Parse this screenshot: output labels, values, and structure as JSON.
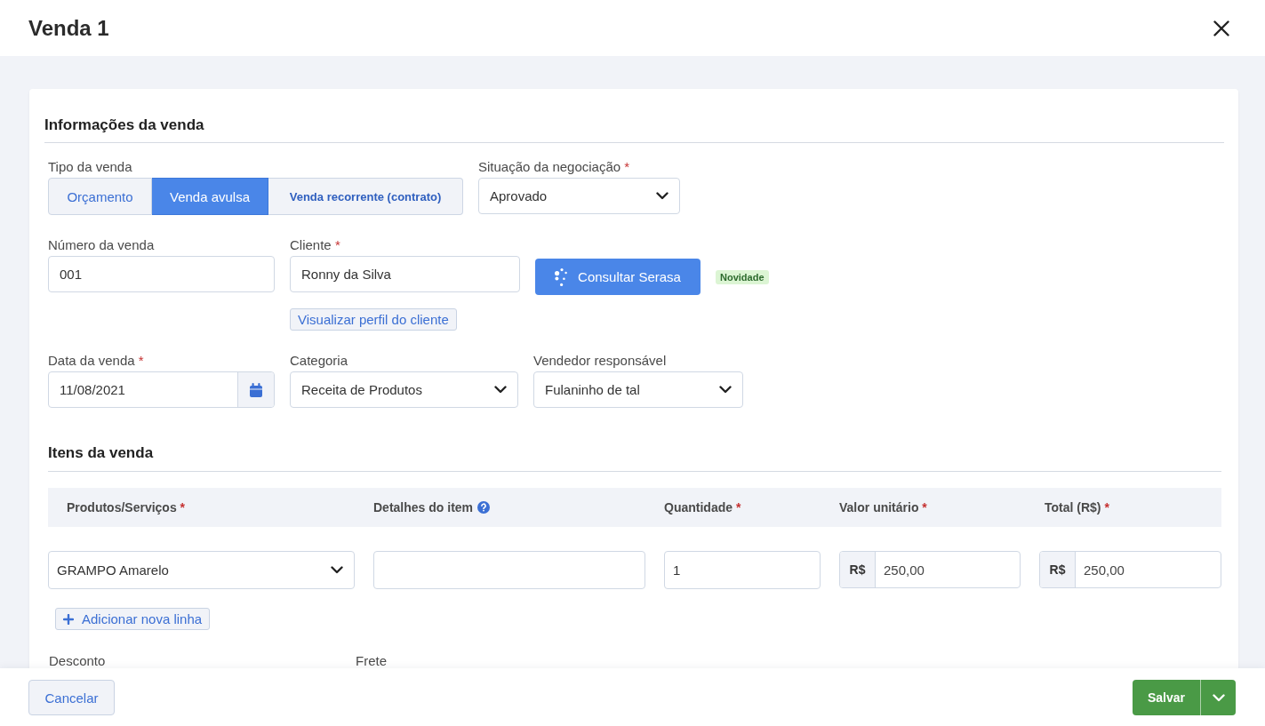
{
  "window": {
    "title": "Venda 1"
  },
  "sale_info": {
    "heading": "Informações da venda",
    "sale_type": {
      "label": "Tipo da venda",
      "options": [
        {
          "label": "Orçamento",
          "selected": false
        },
        {
          "label": "Venda avulsa",
          "selected": true
        },
        {
          "label": "Venda recorrente (contrato)",
          "selected": false
        }
      ]
    },
    "negotiation_status": {
      "label": "Situação da negociação",
      "required_mark": "*",
      "value": "Aprovado"
    },
    "sale_number": {
      "label": "Número da venda",
      "value": "001"
    },
    "client": {
      "label": "Cliente",
      "required_mark": "*",
      "value": "Ronny da Silva",
      "profile_link": "Visualizar perfil do cliente"
    },
    "serasa_button": {
      "label": "Consultar Serasa",
      "badge": "Novidade"
    },
    "sale_date": {
      "label": "Data da venda",
      "required_mark": "*",
      "value": "11/08/2021"
    },
    "category": {
      "label": "Categoria",
      "value": "Receita de Produtos"
    },
    "seller": {
      "label": "Vendedor responsável",
      "value": "Fulaninho de tal"
    }
  },
  "items": {
    "heading": "Itens da venda",
    "columns": [
      {
        "label": "Produtos/Serviços",
        "required_mark": "*",
        "help": false
      },
      {
        "label": "Detalhes do item",
        "help": true
      },
      {
        "label": "Quantidade",
        "required_mark": "*",
        "help": false
      },
      {
        "label": "Valor unitário",
        "required_mark": "*",
        "help": false
      },
      {
        "label": "Total (R$)",
        "required_mark": "*",
        "help": false
      }
    ],
    "rows": [
      {
        "cells": [
          {
            "kind": "select",
            "value": "GRAMPO Amarelo"
          },
          {
            "kind": "text"
          },
          {
            "kind": "text",
            "value": "1"
          },
          {
            "kind": "currency",
            "prefix": "R$",
            "value": "250,00"
          },
          {
            "kind": "currency",
            "prefix": "R$",
            "value": "250,00"
          }
        ]
      }
    ],
    "add_row_button": "Adicionar nova linha"
  },
  "adjustments": [
    {
      "label": "Desconto"
    },
    {
      "label": "Frete"
    }
  ],
  "footer": {
    "cancel_button": "Cancelar",
    "save_button": "Salvar"
  }
}
